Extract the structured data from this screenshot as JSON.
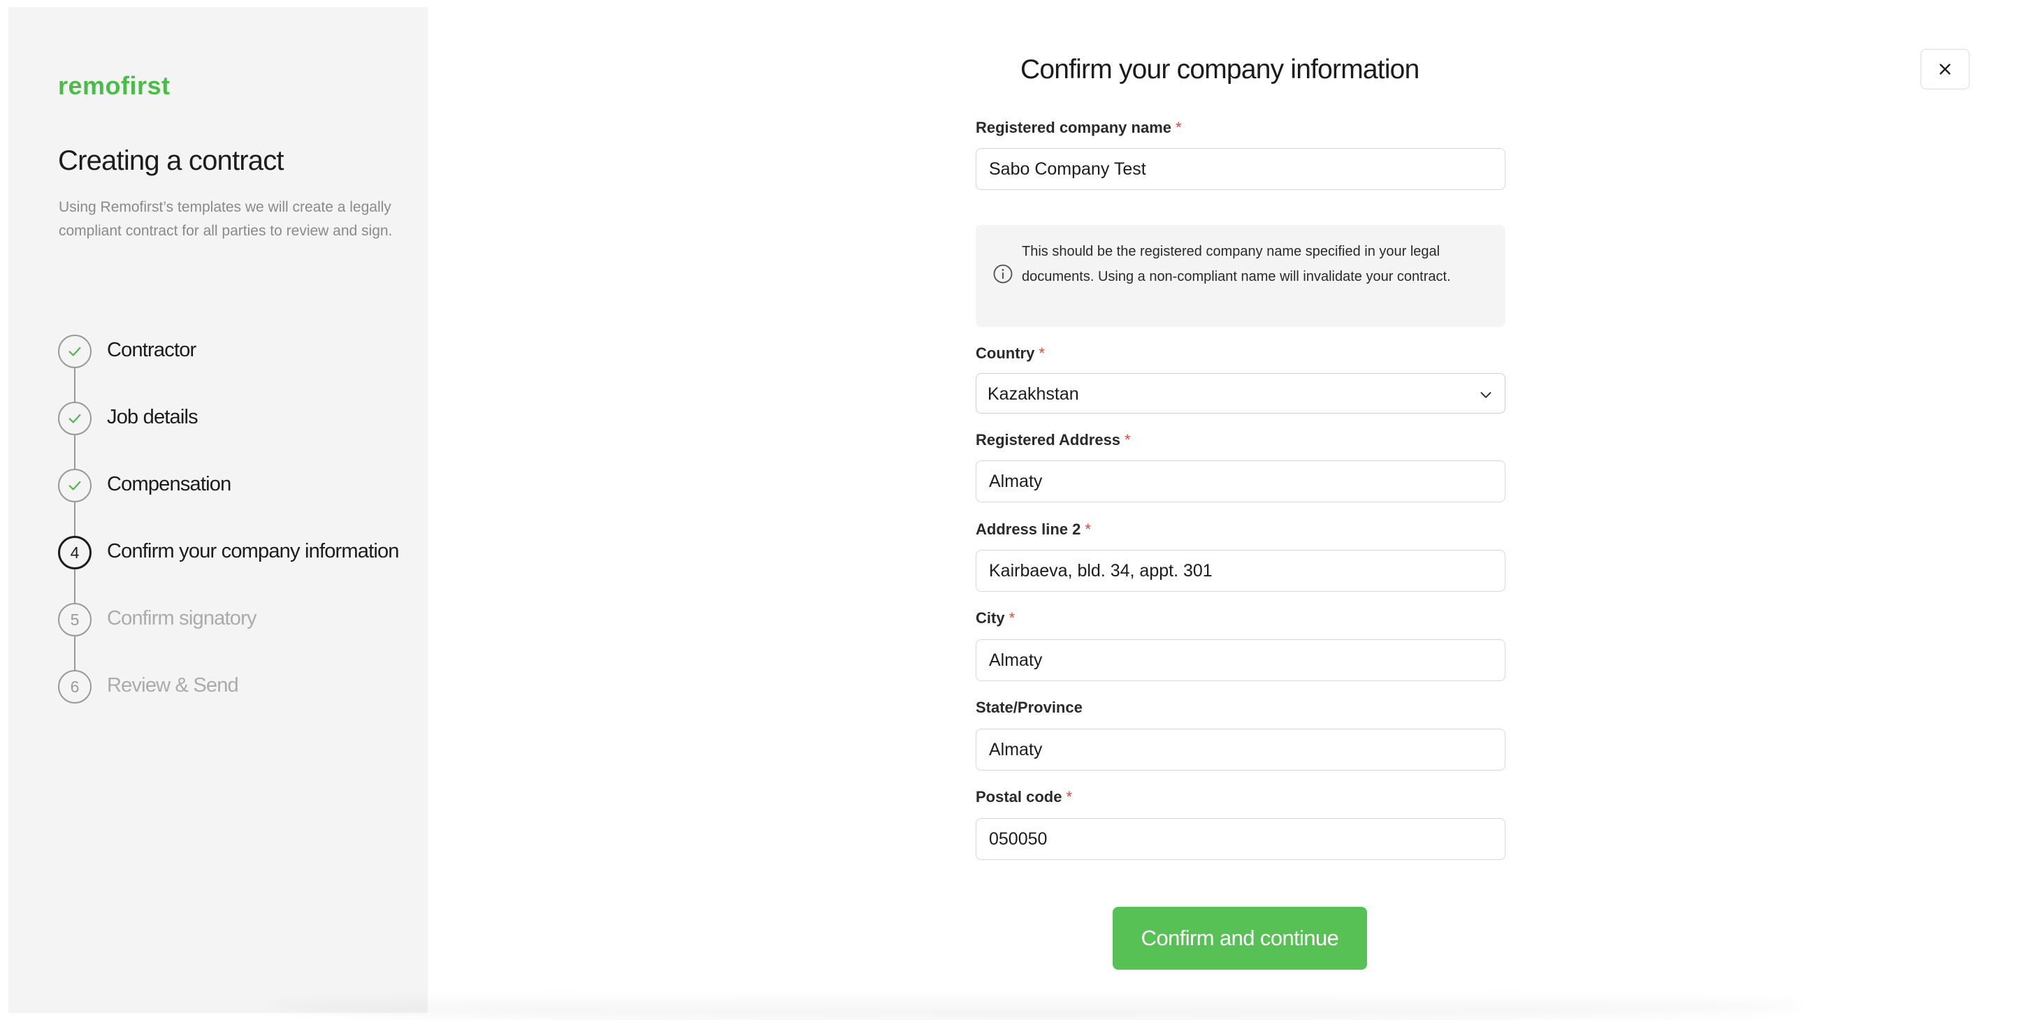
{
  "sidebar": {
    "logo": "remofirst",
    "title": "Creating a contract",
    "description": "Using Remofirst’s templates we will create a legally compliant contract for all parties to review and sign.",
    "steps": [
      {
        "label": "Contractor",
        "status": "done",
        "number": "1"
      },
      {
        "label": "Job details",
        "status": "done",
        "number": "2"
      },
      {
        "label": "Compensation",
        "status": "done",
        "number": "3"
      },
      {
        "label": "Confirm your company information",
        "status": "active",
        "number": "4"
      },
      {
        "label": "Confirm signatory",
        "status": "pending",
        "number": "5"
      },
      {
        "label": "Review & Send",
        "status": "pending",
        "number": "6"
      }
    ]
  },
  "main": {
    "title": "Confirm your company information",
    "close_icon": "close-icon"
  },
  "form": {
    "company_name": {
      "label": "Registered company name",
      "required": "*",
      "value": "Sabo Company Test"
    },
    "info": {
      "icon": "info-icon",
      "text": "This should be the registered company name specified in your legal documents. Using a non-compliant name will invalidate your contract."
    },
    "country": {
      "label": "Country",
      "required": "*",
      "value": "Kazakhstan"
    },
    "address": {
      "label": "Registered Address",
      "required": "*",
      "value": "Almaty"
    },
    "address2": {
      "label": "Address line 2",
      "required": "*",
      "value": "Kairbaeva, bld. 34, appt. 301"
    },
    "city": {
      "label": "City",
      "required": "*",
      "value": "Almaty"
    },
    "state": {
      "label": "State/Province",
      "value": "Almaty"
    },
    "postal": {
      "label": "Postal code",
      "required": "*",
      "value": "050050"
    },
    "submit_label": "Confirm and continue"
  },
  "colors": {
    "brand": "#4cbb4a",
    "button": "#58c155",
    "required": "#e0463c"
  }
}
